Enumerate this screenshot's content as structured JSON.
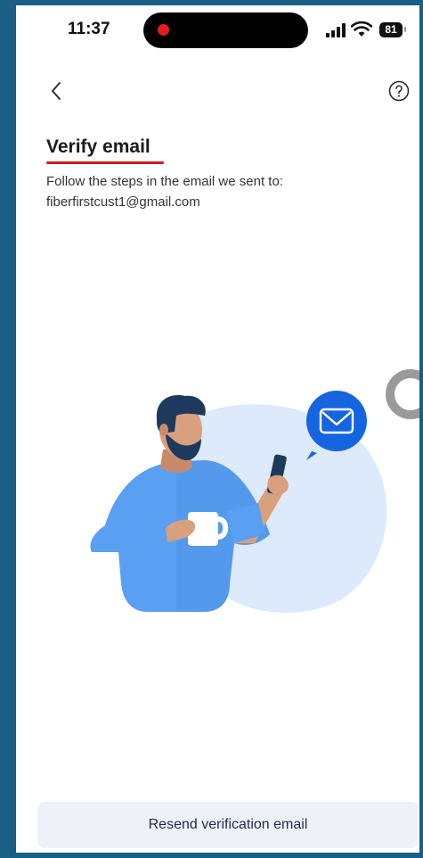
{
  "status_bar": {
    "time": "11:37",
    "battery": "81"
  },
  "nav": {
    "back_icon": "chevron-left-icon",
    "help_icon": "help-circle-icon"
  },
  "page": {
    "title": "Verify email",
    "instruction": "Follow the steps in the email we sent to:",
    "email": "fiberfirstcust1@gmail.com"
  },
  "illustration": {
    "description_icon": "email-illustration",
    "accent_color": "#1565e0",
    "shirt_color": "#5aa0f2"
  },
  "actions": {
    "resend_label": "Resend verification email"
  },
  "colors": {
    "frame": "#1a5f86",
    "title_underline": "#d11a1a",
    "button_bg": "#eef1f8"
  }
}
